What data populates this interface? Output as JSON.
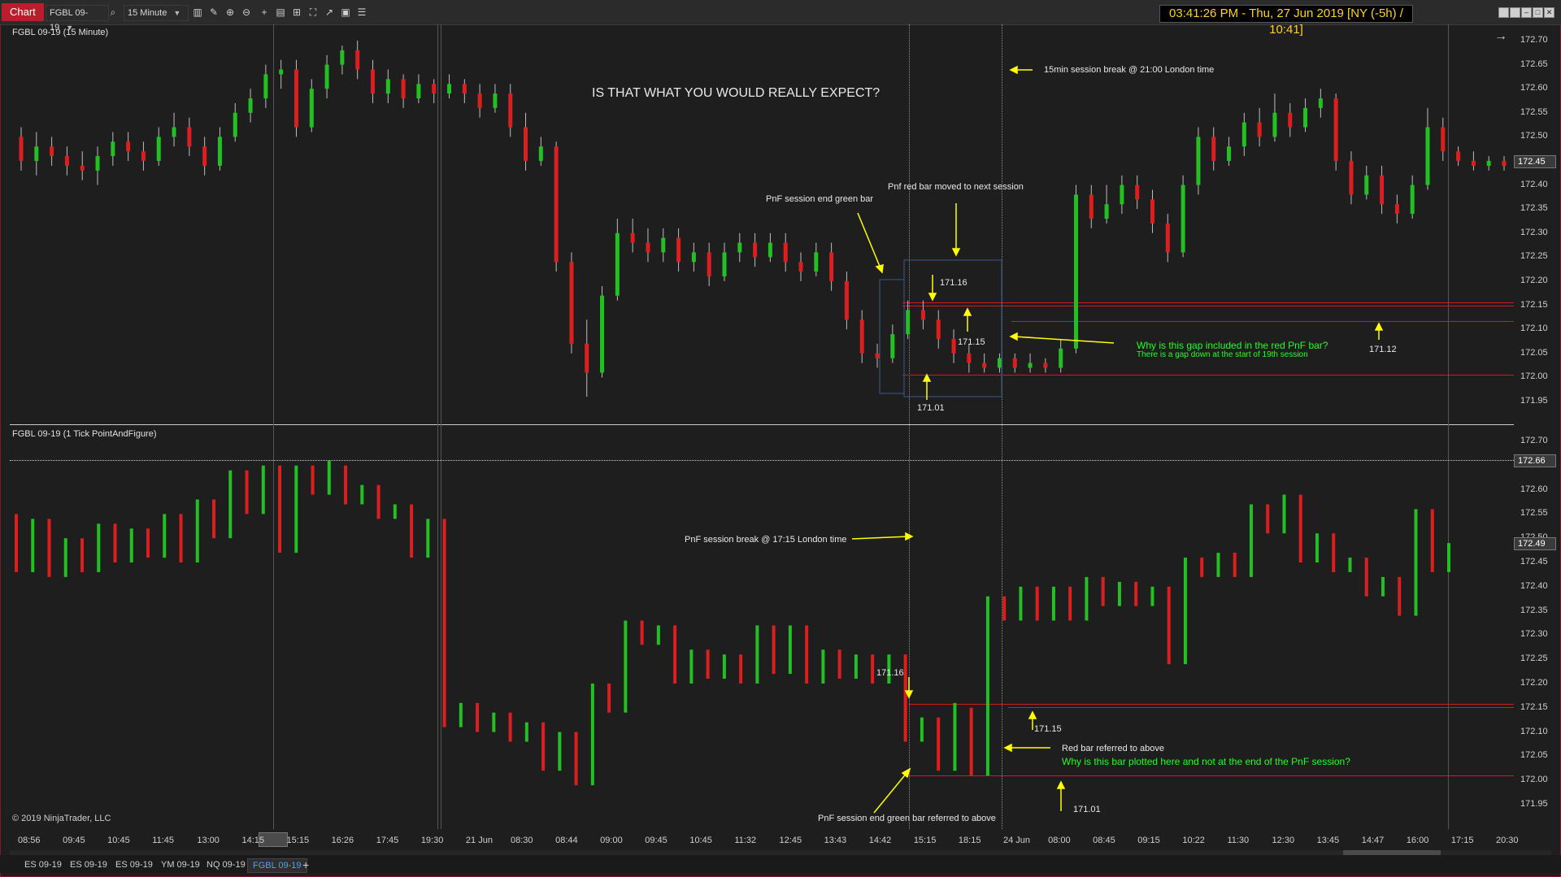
{
  "toolbar": {
    "chart_label": "Chart",
    "instrument": "FGBL 09-19",
    "interval": "15 Minute",
    "clock": "03:41:26 PM - Thu, 27 Jun 2019 [NY (-5h) / 10:41]",
    "icons": [
      "search-icon",
      "bar-style-icon",
      "pencil-icon",
      "zoom-in-icon",
      "zoom-out-icon",
      "crosshair-icon",
      "properties-icon",
      "template-icon",
      "fit-icon",
      "strategy-icon",
      "data-box-icon",
      "list-icon"
    ]
  },
  "top_panel": {
    "title": "FGBL 09-19 (15 Minute)",
    "price_ticks": [
      "172.70",
      "172.65",
      "172.60",
      "172.55",
      "172.50",
      "172.45",
      "172.40",
      "172.35",
      "172.30",
      "172.25",
      "172.20",
      "172.15",
      "172.10",
      "172.05",
      "172.00",
      "171.95"
    ],
    "last_price": "172.45"
  },
  "bottom_panel": {
    "title": "FGBL 09-19 (1 Tick PointAndFigure)",
    "price_ticks": [
      "172.70",
      "172.65",
      "172.60",
      "172.55",
      "172.50",
      "172.45",
      "172.40",
      "172.35",
      "172.30",
      "172.25",
      "172.20",
      "172.15",
      "172.10",
      "172.05",
      "172.00",
      "171.95"
    ],
    "crosshair_price": "172.66",
    "last_price": "172.49"
  },
  "annotations": {
    "headline": "IS THAT WHAT YOU WOULD REALLY EXPECT?",
    "session_break_15min": "15min session break @ 21:00 London time",
    "pnf_end_green": "PnF session end green bar",
    "pnf_red_moved": "Pnf red bar moved to next session",
    "why_gap": "Why is this gap included in the red PnF bar?",
    "gap_down": "There is a gap down at the start of 19th session",
    "pnf_session_break": "PnF session break @ 17:15 London time",
    "red_bar_ref": "Red bar referred to above",
    "why_plotted": "Why is this bar plotted here and not at the end of the PnF session?",
    "pnf_end_green_ref": "PnF session end green bar referred to above",
    "top_171_16": "171.16",
    "top_171_15": "171.15",
    "top_171_01": "171.01",
    "top_171_12": "171.12",
    "bot_171_16": "171.16",
    "bot_171_15": "171.15",
    "bot_171_01": "171.01"
  },
  "time_axis": [
    "08:56",
    "09:45",
    "10:45",
    "11:45",
    "13:00",
    "14:15",
    "15:15",
    "16:26",
    "17:45",
    "19:30",
    "21 Jun",
    "08:30",
    "08:44",
    "09:00",
    "09:45",
    "10:45",
    "11:32",
    "12:45",
    "13:43",
    "14:42",
    "15:15",
    "18:15",
    "24 Jun",
    "08:00",
    "08:45",
    "09:15",
    "10:22",
    "11:30",
    "12:30",
    "13:45",
    "14:47",
    "16:00",
    "17:15",
    "20:30"
  ],
  "copyright": "© 2019 NinjaTrader, LLC",
  "tabs": [
    "ES 09-19",
    "ES 09-19",
    "ES 09-19",
    "YM 09-19",
    "NQ 09-19",
    "FGBL 09-19"
  ],
  "active_tab": "FGBL 09-19",
  "colors": {
    "up": "#22c022",
    "down": "#dd1e1e",
    "accent": "#b81e2b",
    "annotation_arrow": "#ffff00",
    "note_green": "#22ff22"
  },
  "top_candles": [
    [
      172.5,
      172.45,
      172.43,
      172.52
    ],
    [
      172.45,
      172.48,
      172.42,
      172.51
    ],
    [
      172.48,
      172.46,
      172.44,
      172.5
    ],
    [
      172.46,
      172.44,
      172.42,
      172.48
    ],
    [
      172.44,
      172.43,
      172.41,
      172.47
    ],
    [
      172.43,
      172.46,
      172.4,
      172.48
    ],
    [
      172.46,
      172.49,
      172.44,
      172.51
    ],
    [
      172.49,
      172.47,
      172.45,
      172.51
    ],
    [
      172.47,
      172.45,
      172.43,
      172.49
    ],
    [
      172.45,
      172.5,
      172.44,
      172.52
    ],
    [
      172.5,
      172.52,
      172.48,
      172.55
    ],
    [
      172.52,
      172.48,
      172.46,
      172.54
    ],
    [
      172.48,
      172.44,
      172.42,
      172.5
    ],
    [
      172.44,
      172.5,
      172.43,
      172.52
    ],
    [
      172.5,
      172.55,
      172.49,
      172.57
    ],
    [
      172.55,
      172.58,
      172.53,
      172.6
    ],
    [
      172.58,
      172.63,
      172.56,
      172.65
    ],
    [
      172.63,
      172.64,
      172.6,
      172.66
    ],
    [
      172.64,
      172.52,
      172.5,
      172.66
    ],
    [
      172.52,
      172.6,
      172.51,
      172.62
    ],
    [
      172.6,
      172.65,
      172.58,
      172.67
    ],
    [
      172.65,
      172.68,
      172.63,
      172.69
    ],
    [
      172.68,
      172.64,
      172.62,
      172.7
    ],
    [
      172.64,
      172.59,
      172.57,
      172.66
    ],
    [
      172.59,
      172.62,
      172.57,
      172.64
    ],
    [
      172.62,
      172.58,
      172.56,
      172.63
    ],
    [
      172.58,
      172.61,
      172.57,
      172.63
    ],
    [
      172.61,
      172.59,
      172.57,
      172.62
    ],
    [
      172.59,
      172.61,
      172.58,
      172.63
    ],
    [
      172.61,
      172.59,
      172.57,
      172.62
    ],
    [
      172.59,
      172.56,
      172.54,
      172.61
    ],
    [
      172.56,
      172.59,
      172.55,
      172.61
    ],
    [
      172.59,
      172.52,
      172.5,
      172.61
    ],
    [
      172.52,
      172.45,
      172.43,
      172.55
    ],
    [
      172.45,
      172.48,
      172.44,
      172.5
    ],
    [
      172.48,
      172.24,
      172.22,
      172.49
    ],
    [
      172.24,
      172.07,
      172.05,
      172.26
    ],
    [
      172.07,
      172.01,
      171.96,
      172.12
    ],
    [
      172.01,
      172.17,
      172.0,
      172.19
    ],
    [
      172.17,
      172.3,
      172.16,
      172.33
    ],
    [
      172.3,
      172.28,
      172.26,
      172.33
    ],
    [
      172.28,
      172.26,
      172.24,
      172.31
    ],
    [
      172.26,
      172.29,
      172.24,
      172.31
    ],
    [
      172.29,
      172.24,
      172.22,
      172.31
    ],
    [
      172.24,
      172.26,
      172.22,
      172.28
    ],
    [
      172.26,
      172.21,
      172.19,
      172.28
    ],
    [
      172.21,
      172.26,
      172.2,
      172.28
    ],
    [
      172.26,
      172.28,
      172.24,
      172.3
    ],
    [
      172.28,
      172.25,
      172.23,
      172.3
    ],
    [
      172.25,
      172.28,
      172.24,
      172.3
    ],
    [
      172.28,
      172.24,
      172.22,
      172.3
    ],
    [
      172.24,
      172.22,
      172.2,
      172.26
    ],
    [
      172.22,
      172.26,
      172.21,
      172.28
    ],
    [
      172.26,
      172.2,
      172.18,
      172.28
    ],
    [
      172.2,
      172.12,
      172.1,
      172.22
    ],
    [
      172.12,
      172.05,
      172.03,
      172.14
    ],
    [
      172.05,
      172.04,
      172.02,
      172.07
    ],
    [
      172.04,
      172.09,
      172.03,
      172.11
    ],
    [
      172.09,
      172.14,
      172.08,
      172.16
    ],
    [
      172.14,
      172.12,
      172.1,
      172.16
    ],
    [
      172.12,
      172.08,
      172.06,
      172.14
    ],
    [
      172.08,
      172.05,
      172.03,
      172.1
    ],
    [
      172.05,
      172.03,
      172.01,
      172.07
    ],
    [
      172.03,
      172.02,
      172.01,
      172.05
    ],
    [
      172.02,
      172.04,
      172.01,
      172.05
    ],
    [
      172.04,
      172.02,
      172.01,
      172.05
    ],
    [
      172.02,
      172.03,
      172.01,
      172.05
    ],
    [
      172.03,
      172.02,
      172.01,
      172.04
    ],
    [
      172.02,
      172.06,
      172.01,
      172.08
    ],
    [
      172.06,
      172.38,
      172.05,
      172.4
    ],
    [
      172.38,
      172.33,
      172.31,
      172.4
    ],
    [
      172.33,
      172.36,
      172.32,
      172.4
    ],
    [
      172.36,
      172.4,
      172.34,
      172.42
    ],
    [
      172.4,
      172.37,
      172.35,
      172.42
    ],
    [
      172.37,
      172.32,
      172.3,
      172.39
    ],
    [
      172.32,
      172.26,
      172.24,
      172.34
    ],
    [
      172.26,
      172.4,
      172.25,
      172.42
    ],
    [
      172.4,
      172.5,
      172.38,
      172.52
    ],
    [
      172.5,
      172.45,
      172.43,
      172.52
    ],
    [
      172.45,
      172.48,
      172.44,
      172.5
    ],
    [
      172.48,
      172.53,
      172.46,
      172.55
    ],
    [
      172.53,
      172.5,
      172.48,
      172.56
    ],
    [
      172.5,
      172.55,
      172.49,
      172.59
    ],
    [
      172.55,
      172.52,
      172.5,
      172.57
    ],
    [
      172.52,
      172.56,
      172.51,
      172.58
    ],
    [
      172.56,
      172.58,
      172.54,
      172.6
    ],
    [
      172.58,
      172.45,
      172.43,
      172.59
    ],
    [
      172.45,
      172.38,
      172.36,
      172.47
    ],
    [
      172.38,
      172.42,
      172.37,
      172.44
    ],
    [
      172.42,
      172.36,
      172.34,
      172.44
    ],
    [
      172.36,
      172.34,
      172.32,
      172.38
    ],
    [
      172.34,
      172.4,
      172.33,
      172.42
    ],
    [
      172.4,
      172.52,
      172.39,
      172.56
    ],
    [
      172.52,
      172.47,
      172.45,
      172.54
    ],
    [
      172.47,
      172.45,
      172.44,
      172.48
    ],
    [
      172.45,
      172.44,
      172.43,
      172.47
    ],
    [
      172.44,
      172.45,
      172.43,
      172.46
    ],
    [
      172.45,
      172.44,
      172.43,
      172.46
    ]
  ],
  "bottom_bars": [
    [
      172.55,
      172.43,
      0
    ],
    [
      172.43,
      172.54,
      1
    ],
    [
      172.54,
      172.42,
      0
    ],
    [
      172.42,
      172.5,
      1
    ],
    [
      172.5,
      172.43,
      0
    ],
    [
      172.43,
      172.53,
      1
    ],
    [
      172.53,
      172.45,
      0
    ],
    [
      172.45,
      172.52,
      1
    ],
    [
      172.52,
      172.46,
      0
    ],
    [
      172.46,
      172.55,
      1
    ],
    [
      172.55,
      172.45,
      0
    ],
    [
      172.45,
      172.58,
      1
    ],
    [
      172.58,
      172.5,
      0
    ],
    [
      172.5,
      172.64,
      1
    ],
    [
      172.64,
      172.55,
      0
    ],
    [
      172.55,
      172.65,
      1
    ],
    [
      172.65,
      172.47,
      0
    ],
    [
      172.47,
      172.65,
      1
    ],
    [
      172.65,
      172.59,
      0
    ],
    [
      172.59,
      172.66,
      1
    ],
    [
      172.65,
      172.57,
      0
    ],
    [
      172.57,
      172.61,
      1
    ],
    [
      172.61,
      172.54,
      0
    ],
    [
      172.54,
      172.57,
      1
    ],
    [
      172.57,
      172.46,
      0
    ],
    [
      172.46,
      172.54,
      1
    ],
    [
      172.54,
      172.11,
      0
    ],
    [
      172.11,
      172.16,
      1
    ],
    [
      172.16,
      172.1,
      0
    ],
    [
      172.1,
      172.14,
      1
    ],
    [
      172.14,
      172.08,
      0
    ],
    [
      172.08,
      172.12,
      1
    ],
    [
      172.12,
      172.02,
      0
    ],
    [
      172.02,
      172.1,
      1
    ],
    [
      172.1,
      171.99,
      0
    ],
    [
      171.99,
      172.2,
      1
    ],
    [
      172.2,
      172.14,
      0
    ],
    [
      172.14,
      172.33,
      1
    ],
    [
      172.33,
      172.28,
      0
    ],
    [
      172.28,
      172.32,
      1
    ],
    [
      172.32,
      172.2,
      0
    ],
    [
      172.2,
      172.27,
      1
    ],
    [
      172.27,
      172.21,
      0
    ],
    [
      172.21,
      172.26,
      1
    ],
    [
      172.26,
      172.2,
      0
    ],
    [
      172.2,
      172.32,
      1
    ],
    [
      172.32,
      172.22,
      0
    ],
    [
      172.22,
      172.32,
      1
    ],
    [
      172.32,
      172.2,
      0
    ],
    [
      172.2,
      172.27,
      1
    ],
    [
      172.27,
      172.21,
      0
    ],
    [
      172.21,
      172.26,
      1
    ],
    [
      172.26,
      172.2,
      0
    ],
    [
      172.2,
      172.26,
      1
    ],
    [
      172.26,
      172.08,
      0
    ],
    [
      172.08,
      172.13,
      1
    ],
    [
      172.13,
      172.02,
      0
    ],
    [
      172.02,
      172.16,
      1
    ],
    [
      172.15,
      172.01,
      0
    ],
    [
      172.01,
      172.38,
      1
    ],
    [
      172.38,
      172.33,
      0
    ],
    [
      172.33,
      172.4,
      1
    ],
    [
      172.4,
      172.33,
      0
    ],
    [
      172.33,
      172.4,
      1
    ],
    [
      172.4,
      172.33,
      0
    ],
    [
      172.33,
      172.42,
      1
    ],
    [
      172.42,
      172.36,
      0
    ],
    [
      172.36,
      172.41,
      1
    ],
    [
      172.41,
      172.36,
      0
    ],
    [
      172.36,
      172.4,
      1
    ],
    [
      172.4,
      172.24,
      0
    ],
    [
      172.24,
      172.46,
      1
    ],
    [
      172.46,
      172.42,
      0
    ],
    [
      172.42,
      172.47,
      1
    ],
    [
      172.47,
      172.42,
      0
    ],
    [
      172.42,
      172.57,
      1
    ],
    [
      172.57,
      172.51,
      0
    ],
    [
      172.51,
      172.59,
      1
    ],
    [
      172.59,
      172.45,
      0
    ],
    [
      172.45,
      172.51,
      1
    ],
    [
      172.51,
      172.43,
      0
    ],
    [
      172.43,
      172.46,
      1
    ],
    [
      172.46,
      172.38,
      0
    ],
    [
      172.38,
      172.42,
      1
    ],
    [
      172.42,
      172.34,
      0
    ],
    [
      172.34,
      172.56,
      1
    ],
    [
      172.56,
      172.43,
      0
    ],
    [
      172.43,
      172.49,
      1
    ]
  ]
}
